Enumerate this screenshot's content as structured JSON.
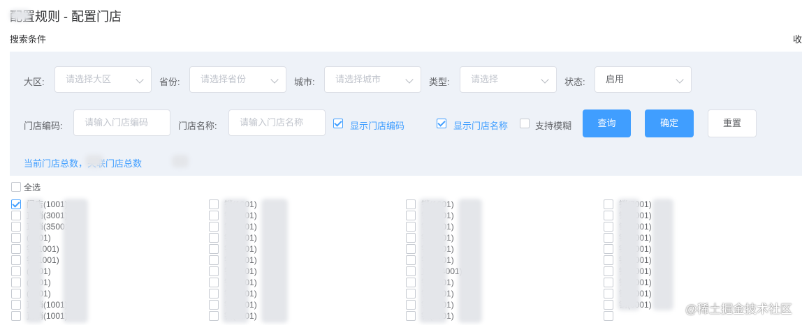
{
  "page": {
    "title": "配置规则 - 配置门店",
    "search_section_label": "搜索条件",
    "collapse_label": "收"
  },
  "filters": {
    "region": {
      "label": "大区:",
      "placeholder": "请选择大区"
    },
    "province": {
      "label": "省份:",
      "placeholder": "请选择省份"
    },
    "city": {
      "label": "城市:",
      "placeholder": "请选择城市"
    },
    "type": {
      "label": "类型:",
      "placeholder": "请选择"
    },
    "status": {
      "label": "状态:",
      "value": "启用"
    },
    "store_code": {
      "label": "门店编码:",
      "placeholder": "请输入门店编码"
    },
    "store_name": {
      "label": "门店名称:",
      "placeholder": "请输入门店名称"
    },
    "show_code": {
      "label": "显示门店编码",
      "checked": true
    },
    "show_name": {
      "label": "显示门店名称",
      "checked": true
    },
    "fuzzy": {
      "label": "支持模糊",
      "checked": false
    }
  },
  "buttons": {
    "query": "查询",
    "confirm": "确定",
    "reset": "重置"
  },
  "summary": {
    "text": "当前门店总数，关联门店总数"
  },
  "select_all": {
    "label": "全选",
    "checked": false
  },
  "stores": {
    "col1": [
      {
        "label": "门店(1001)",
        "checked": true
      },
      {
        "label": "直销(3001)",
        "checked": false
      },
      {
        "label": "直销(35001)",
        "checked": false
      },
      {
        "label": "(1001)",
        "checked": false
      },
      {
        "label": "销(1001)",
        "checked": false
      },
      {
        "label": "销(1001)",
        "checked": false
      },
      {
        "label": "(1001)",
        "checked": false
      },
      {
        "label": "(1001)",
        "checked": false
      },
      {
        "label": "(1001)",
        "checked": false
      },
      {
        "label": "直销(1001)",
        "checked": false
      },
      {
        "label": "直销(1001)",
        "checked": false
      }
    ],
    "col2": [
      {
        "label": "销(1001)",
        "checked": false
      },
      {
        "label": "销(1001)",
        "checked": false
      },
      {
        "label": "销(1001)",
        "checked": false
      },
      {
        "label": "销(1001)",
        "checked": false
      },
      {
        "label": "销(1001)",
        "checked": false
      },
      {
        "label": "销(1001)",
        "checked": false
      },
      {
        "label": "销(1001)",
        "checked": false
      },
      {
        "label": "销(1001)",
        "checked": false
      },
      {
        "label": "销(1001)",
        "checked": false
      },
      {
        "label": "销(1001)",
        "checked": false
      },
      {
        "label": "销(1001)",
        "checked": false
      }
    ],
    "col3": [
      {
        "label": "销(1001)",
        "checked": false
      },
      {
        "label": "销(1001)",
        "checked": false
      },
      {
        "label": "销(1001)",
        "checked": false
      },
      {
        "label": "销(1001)",
        "checked": false
      },
      {
        "label": "销(1001)",
        "checked": false
      },
      {
        "label": "销(0001)",
        "checked": false
      },
      {
        "label": "直销(4001)",
        "checked": false
      },
      {
        "label": "销(1001)",
        "checked": false
      },
      {
        "label": "销(1001)",
        "checked": false
      },
      {
        "label": "销(1001)",
        "checked": false
      },
      {
        "label": "销(2001)",
        "checked": false
      }
    ],
    "col4": [
      {
        "label": "销(7001)",
        "checked": false
      },
      {
        "label": "销(3001)",
        "checked": false
      },
      {
        "label": "销(1001)",
        "checked": false
      },
      {
        "label": "销(5001)",
        "checked": false
      },
      {
        "label": "销(3001)",
        "checked": false
      },
      {
        "label": "销(7001)",
        "checked": false
      },
      {
        "label": "销(3001)",
        "checked": false
      },
      {
        "label": "销(3001)",
        "checked": false
      },
      {
        "label": "销(0001)",
        "checked": false
      },
      {
        "label": "销(0001)",
        "checked": false
      },
      {
        "label": "",
        "checked": false
      }
    ]
  },
  "watermark": "@稀土掘金技术社区",
  "colors": {
    "accent": "#409eff",
    "panel_bg": "#eef2f8"
  }
}
